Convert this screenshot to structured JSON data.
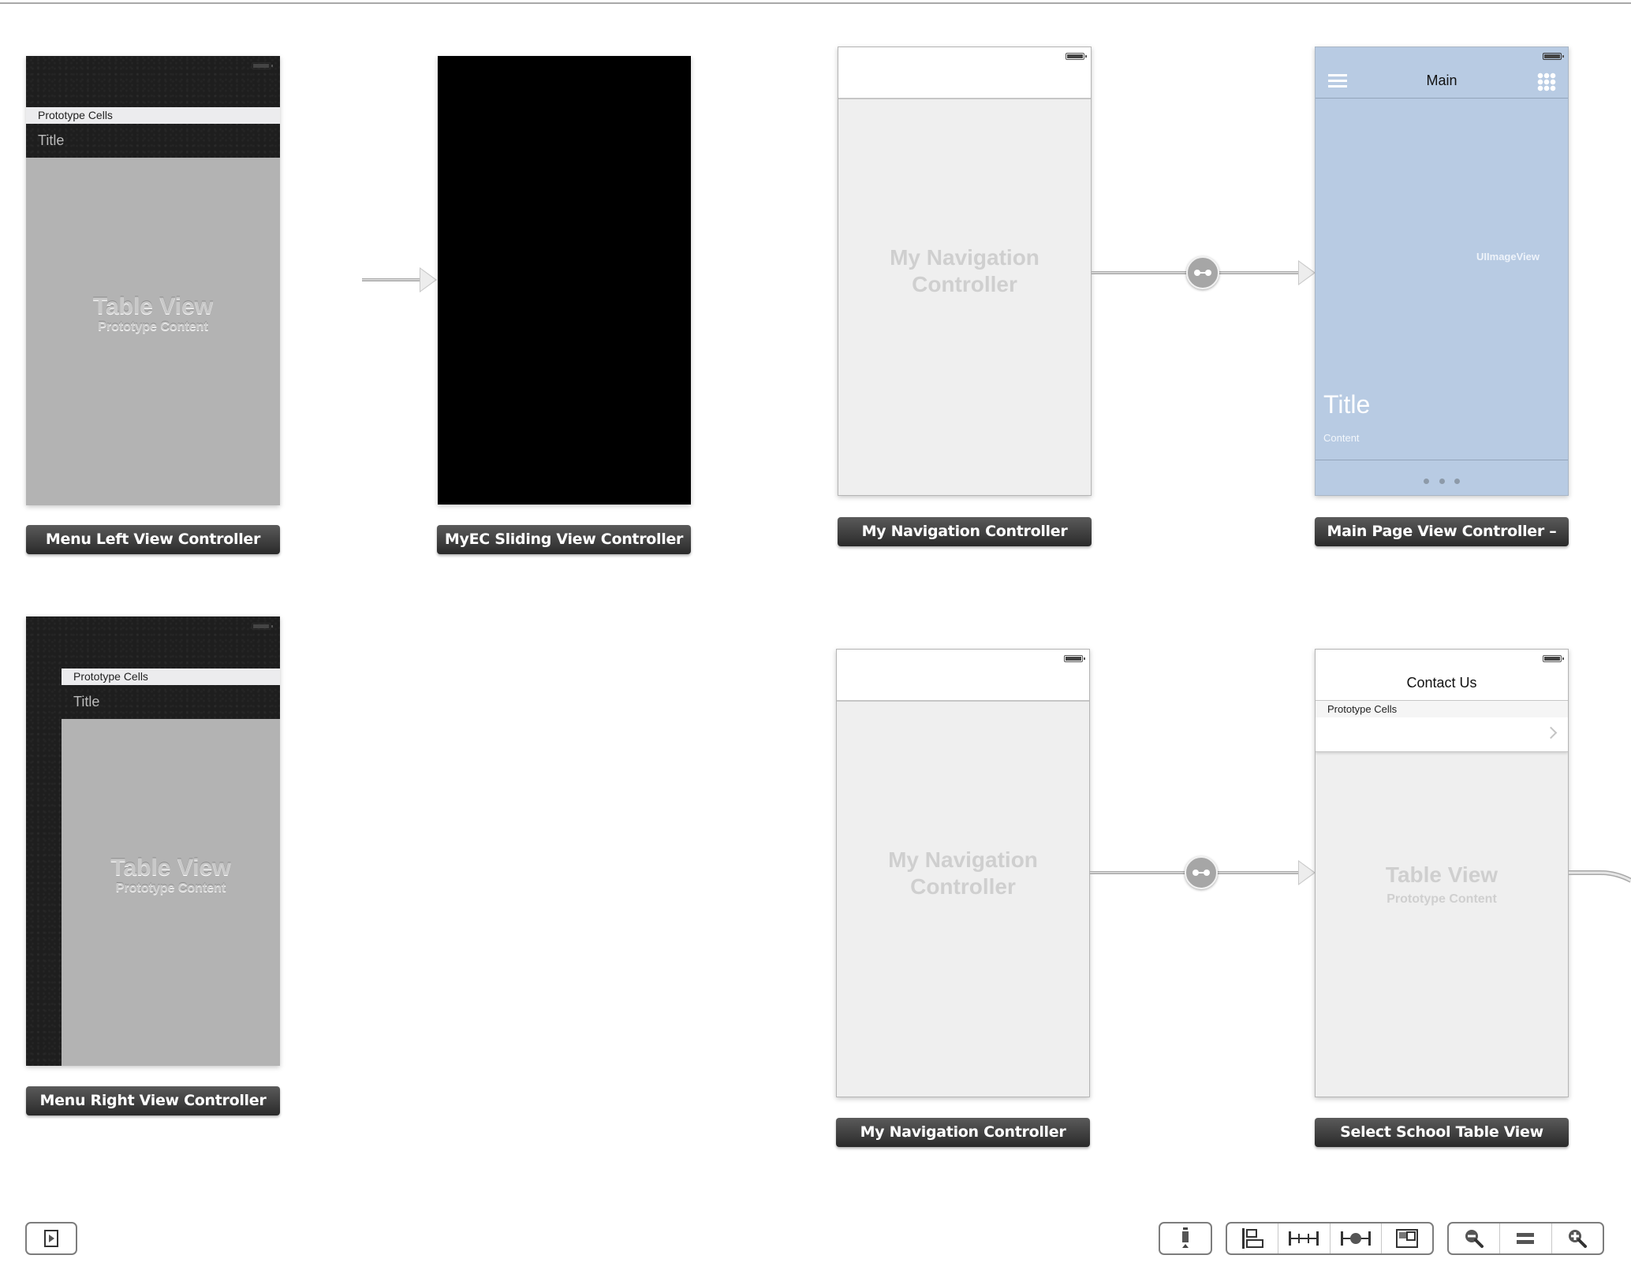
{
  "canvas": {
    "scenes": {
      "menu_left": {
        "section_header": "Prototype Cells",
        "cell_title": "Title",
        "placeholder_title": "Table View",
        "placeholder_subtitle": "Prototype Content",
        "label": "Menu Left View Controller"
      },
      "sliding": {
        "label": "MyEC Sliding View Controller"
      },
      "nav_top": {
        "placeholder_line1": "My Navigation",
        "placeholder_line2": "Controller",
        "label": "My Navigation Controller"
      },
      "main_page": {
        "nav_title": "Main",
        "image_view_label": "UIImageView",
        "title": "Title",
        "content": "Content",
        "label": "Main Page View Controller –",
        "background_color": "#b8cbe3"
      },
      "menu_right": {
        "section_header": "Prototype Cells",
        "cell_title": "Title",
        "placeholder_title": "Table View",
        "placeholder_subtitle": "Prototype Content",
        "label": "Menu Right View Controller"
      },
      "nav_bottom": {
        "placeholder_line1": "My Navigation",
        "placeholder_line2": "Controller",
        "label": "My Navigation Controller"
      },
      "select_school": {
        "nav_title": "Contact Us",
        "section_header": "Prototype Cells",
        "placeholder_title": "Table View",
        "placeholder_subtitle": "Prototype Content",
        "label": "Select School Table View"
      }
    }
  },
  "toolbar": {
    "left": [
      {
        "icon": "simulated-metrics-toggle-icon"
      }
    ],
    "right_groups": [
      [
        {
          "icon": "resolve-constraints-icon"
        }
      ],
      [
        {
          "icon": "align-icon"
        },
        {
          "icon": "pin-icon"
        },
        {
          "icon": "resolve-autolayout-issues-icon"
        },
        {
          "icon": "resizing-behavior-icon"
        }
      ],
      [
        {
          "icon": "zoom-out-icon"
        },
        {
          "icon": "zoom-actual-size-icon"
        },
        {
          "icon": "zoom-in-icon"
        }
      ]
    ]
  }
}
